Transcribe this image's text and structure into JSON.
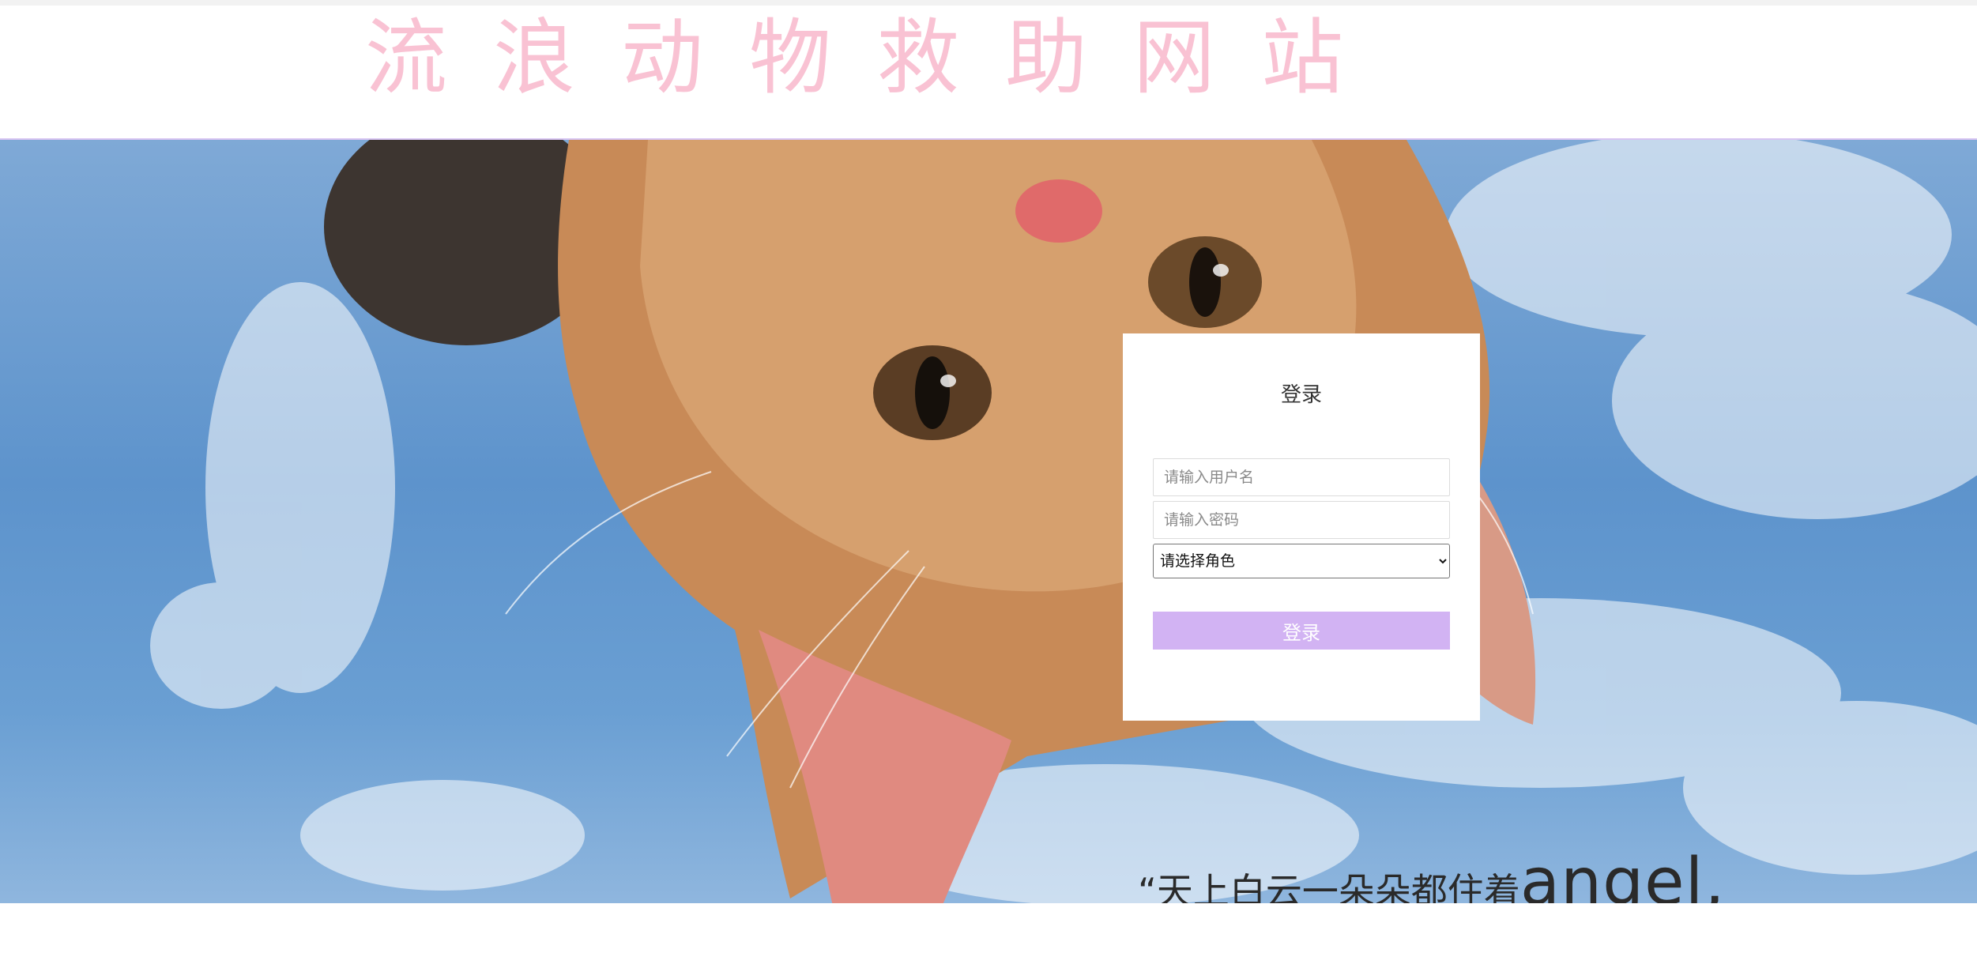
{
  "header": {
    "site_title": "流浪动物救助网站"
  },
  "hero": {
    "image_description_icon": "cat-photo",
    "quote_cn": "“天上白云一朵朵都住着",
    "quote_latin": "angel,"
  },
  "login": {
    "title": "登录",
    "username_placeholder": "请输入用户名",
    "password_placeholder": "请输入密码",
    "role_selected": "请选择角色",
    "submit_label": "登录"
  },
  "colors": {
    "title_pink": "#f9c2d3",
    "button_purple": "#d2b3f3",
    "header_border": "#d7c4f2"
  }
}
